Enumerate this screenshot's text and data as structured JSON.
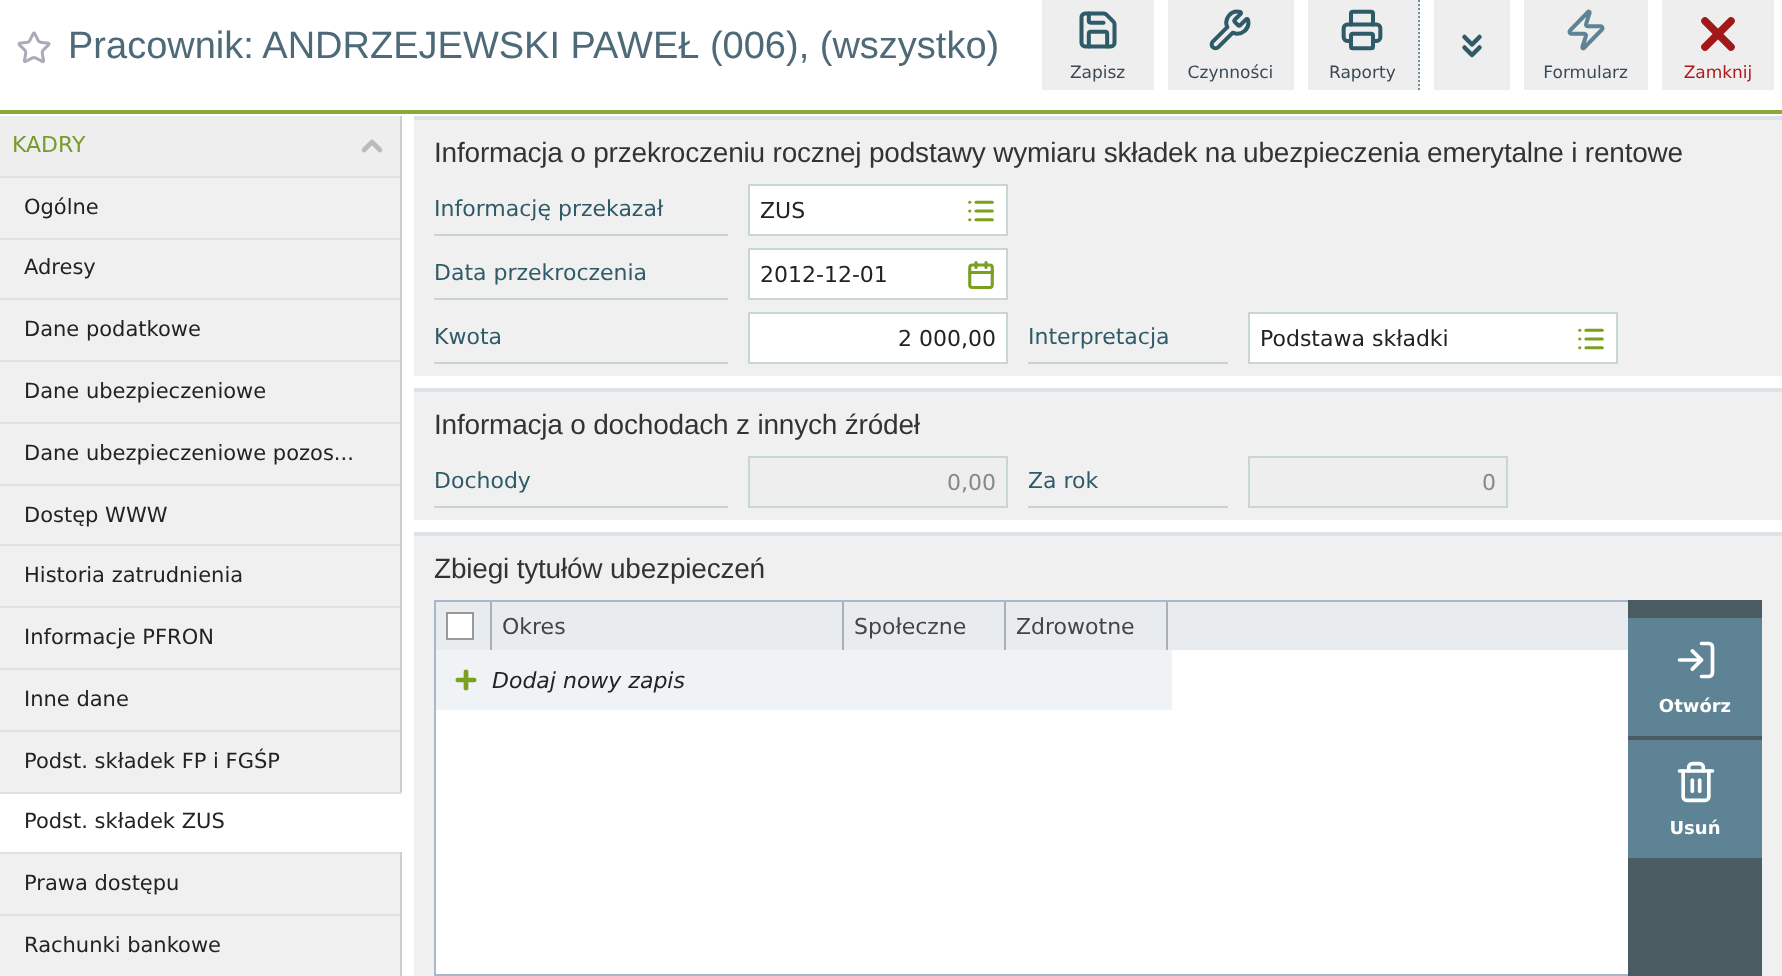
{
  "header": {
    "title": "Pracownik: ANDRZEJEWSKI PAWEŁ (006), (wszystko)",
    "favorite": false
  },
  "toolbar": [
    {
      "kind": "save",
      "label": "Zapisz"
    },
    {
      "kind": "actions",
      "label": "Czynności"
    },
    {
      "kind": "reports",
      "label": "Raporty"
    },
    {
      "kind": "more"
    },
    {
      "kind": "form",
      "label": "Formularz"
    },
    {
      "kind": "close",
      "label": "Zamknij"
    }
  ],
  "sidebar": {
    "group": "KADRY",
    "expanded": true,
    "items": [
      {
        "label": "Ogólne",
        "selected": false
      },
      {
        "label": "Adresy",
        "selected": false
      },
      {
        "label": "Dane podatkowe",
        "selected": false
      },
      {
        "label": "Dane ubezpieczeniowe",
        "selected": false
      },
      {
        "label": "Dane ubezpieczeniowe pozos...",
        "selected": false
      },
      {
        "label": "Dostęp WWW",
        "selected": false
      },
      {
        "label": "Historia zatrudnienia",
        "selected": false
      },
      {
        "label": "Informacje PFRON",
        "selected": false
      },
      {
        "label": "Inne dane",
        "selected": false
      },
      {
        "label": "Podst. składek FP i FGŚP",
        "selected": false
      },
      {
        "label": "Podst. składek ZUS",
        "selected": true
      },
      {
        "label": "Prawa dostępu",
        "selected": false
      },
      {
        "label": "Rachunki bankowe",
        "selected": false
      }
    ]
  },
  "sections": [
    {
      "title": "Informacja o przekroczeniu rocznej podstawy wymiaru składek na ubezpieczenia emerytalne i rentowe",
      "rows": [
        [
          {
            "label": "Informację przekazał",
            "value": "ZUS",
            "kind": "list",
            "disabled": false
          }
        ],
        [
          {
            "label": "Data przekroczenia",
            "value": "2012-12-01",
            "kind": "date",
            "disabled": false
          }
        ],
        [
          {
            "label": "Kwota",
            "value": "2 000,00",
            "kind": "number",
            "disabled": false
          },
          {
            "label": "Interpretacja",
            "value": "Podstawa składki",
            "kind": "list",
            "disabled": false
          }
        ]
      ]
    },
    {
      "title": "Informacja o dochodach z innych źródeł",
      "rows": [
        [
          {
            "label": "Dochody",
            "value": "0,00",
            "kind": "number",
            "disabled": true
          },
          {
            "label": "Za rok",
            "value": "0",
            "kind": "number",
            "disabled": true
          }
        ]
      ]
    }
  ],
  "table": {
    "title": "Zbiegi tytułów ubezpieczeń",
    "select_all": false,
    "columns": [
      "Okres",
      "Społeczne",
      "Zdrowotne"
    ],
    "add_row": "Dodaj nowy zapis",
    "actions": [
      {
        "kind": "open",
        "label": "Otwórz"
      },
      {
        "kind": "delete",
        "label": "Usuń"
      }
    ]
  }
}
